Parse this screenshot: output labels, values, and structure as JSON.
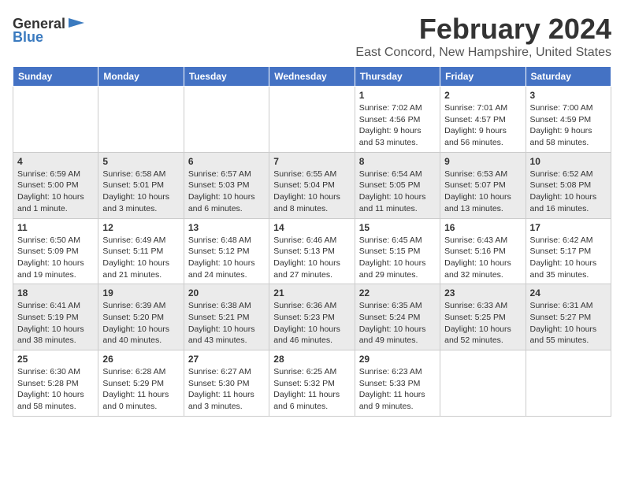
{
  "logo": {
    "general": "General",
    "blue": "Blue"
  },
  "title": "February 2024",
  "subtitle": "East Concord, New Hampshire, United States",
  "headers": [
    "Sunday",
    "Monday",
    "Tuesday",
    "Wednesday",
    "Thursday",
    "Friday",
    "Saturday"
  ],
  "weeks": [
    [
      {
        "day": "",
        "sunrise": "",
        "sunset": "",
        "daylight": ""
      },
      {
        "day": "",
        "sunrise": "",
        "sunset": "",
        "daylight": ""
      },
      {
        "day": "",
        "sunrise": "",
        "sunset": "",
        "daylight": ""
      },
      {
        "day": "",
        "sunrise": "",
        "sunset": "",
        "daylight": ""
      },
      {
        "day": "1",
        "sunrise": "Sunrise: 7:02 AM",
        "sunset": "Sunset: 4:56 PM",
        "daylight": "Daylight: 9 hours and 53 minutes."
      },
      {
        "day": "2",
        "sunrise": "Sunrise: 7:01 AM",
        "sunset": "Sunset: 4:57 PM",
        "daylight": "Daylight: 9 hours and 56 minutes."
      },
      {
        "day": "3",
        "sunrise": "Sunrise: 7:00 AM",
        "sunset": "Sunset: 4:59 PM",
        "daylight": "Daylight: 9 hours and 58 minutes."
      }
    ],
    [
      {
        "day": "4",
        "sunrise": "Sunrise: 6:59 AM",
        "sunset": "Sunset: 5:00 PM",
        "daylight": "Daylight: 10 hours and 1 minute."
      },
      {
        "day": "5",
        "sunrise": "Sunrise: 6:58 AM",
        "sunset": "Sunset: 5:01 PM",
        "daylight": "Daylight: 10 hours and 3 minutes."
      },
      {
        "day": "6",
        "sunrise": "Sunrise: 6:57 AM",
        "sunset": "Sunset: 5:03 PM",
        "daylight": "Daylight: 10 hours and 6 minutes."
      },
      {
        "day": "7",
        "sunrise": "Sunrise: 6:55 AM",
        "sunset": "Sunset: 5:04 PM",
        "daylight": "Daylight: 10 hours and 8 minutes."
      },
      {
        "day": "8",
        "sunrise": "Sunrise: 6:54 AM",
        "sunset": "Sunset: 5:05 PM",
        "daylight": "Daylight: 10 hours and 11 minutes."
      },
      {
        "day": "9",
        "sunrise": "Sunrise: 6:53 AM",
        "sunset": "Sunset: 5:07 PM",
        "daylight": "Daylight: 10 hours and 13 minutes."
      },
      {
        "day": "10",
        "sunrise": "Sunrise: 6:52 AM",
        "sunset": "Sunset: 5:08 PM",
        "daylight": "Daylight: 10 hours and 16 minutes."
      }
    ],
    [
      {
        "day": "11",
        "sunrise": "Sunrise: 6:50 AM",
        "sunset": "Sunset: 5:09 PM",
        "daylight": "Daylight: 10 hours and 19 minutes."
      },
      {
        "day": "12",
        "sunrise": "Sunrise: 6:49 AM",
        "sunset": "Sunset: 5:11 PM",
        "daylight": "Daylight: 10 hours and 21 minutes."
      },
      {
        "day": "13",
        "sunrise": "Sunrise: 6:48 AM",
        "sunset": "Sunset: 5:12 PM",
        "daylight": "Daylight: 10 hours and 24 minutes."
      },
      {
        "day": "14",
        "sunrise": "Sunrise: 6:46 AM",
        "sunset": "Sunset: 5:13 PM",
        "daylight": "Daylight: 10 hours and 27 minutes."
      },
      {
        "day": "15",
        "sunrise": "Sunrise: 6:45 AM",
        "sunset": "Sunset: 5:15 PM",
        "daylight": "Daylight: 10 hours and 29 minutes."
      },
      {
        "day": "16",
        "sunrise": "Sunrise: 6:43 AM",
        "sunset": "Sunset: 5:16 PM",
        "daylight": "Daylight: 10 hours and 32 minutes."
      },
      {
        "day": "17",
        "sunrise": "Sunrise: 6:42 AM",
        "sunset": "Sunset: 5:17 PM",
        "daylight": "Daylight: 10 hours and 35 minutes."
      }
    ],
    [
      {
        "day": "18",
        "sunrise": "Sunrise: 6:41 AM",
        "sunset": "Sunset: 5:19 PM",
        "daylight": "Daylight: 10 hours and 38 minutes."
      },
      {
        "day": "19",
        "sunrise": "Sunrise: 6:39 AM",
        "sunset": "Sunset: 5:20 PM",
        "daylight": "Daylight: 10 hours and 40 minutes."
      },
      {
        "day": "20",
        "sunrise": "Sunrise: 6:38 AM",
        "sunset": "Sunset: 5:21 PM",
        "daylight": "Daylight: 10 hours and 43 minutes."
      },
      {
        "day": "21",
        "sunrise": "Sunrise: 6:36 AM",
        "sunset": "Sunset: 5:23 PM",
        "daylight": "Daylight: 10 hours and 46 minutes."
      },
      {
        "day": "22",
        "sunrise": "Sunrise: 6:35 AM",
        "sunset": "Sunset: 5:24 PM",
        "daylight": "Daylight: 10 hours and 49 minutes."
      },
      {
        "day": "23",
        "sunrise": "Sunrise: 6:33 AM",
        "sunset": "Sunset: 5:25 PM",
        "daylight": "Daylight: 10 hours and 52 minutes."
      },
      {
        "day": "24",
        "sunrise": "Sunrise: 6:31 AM",
        "sunset": "Sunset: 5:27 PM",
        "daylight": "Daylight: 10 hours and 55 minutes."
      }
    ],
    [
      {
        "day": "25",
        "sunrise": "Sunrise: 6:30 AM",
        "sunset": "Sunset: 5:28 PM",
        "daylight": "Daylight: 10 hours and 58 minutes."
      },
      {
        "day": "26",
        "sunrise": "Sunrise: 6:28 AM",
        "sunset": "Sunset: 5:29 PM",
        "daylight": "Daylight: 11 hours and 0 minutes."
      },
      {
        "day": "27",
        "sunrise": "Sunrise: 6:27 AM",
        "sunset": "Sunset: 5:30 PM",
        "daylight": "Daylight: 11 hours and 3 minutes."
      },
      {
        "day": "28",
        "sunrise": "Sunrise: 6:25 AM",
        "sunset": "Sunset: 5:32 PM",
        "daylight": "Daylight: 11 hours and 6 minutes."
      },
      {
        "day": "29",
        "sunrise": "Sunrise: 6:23 AM",
        "sunset": "Sunset: 5:33 PM",
        "daylight": "Daylight: 11 hours and 9 minutes."
      },
      {
        "day": "",
        "sunrise": "",
        "sunset": "",
        "daylight": ""
      },
      {
        "day": "",
        "sunrise": "",
        "sunset": "",
        "daylight": ""
      }
    ]
  ]
}
